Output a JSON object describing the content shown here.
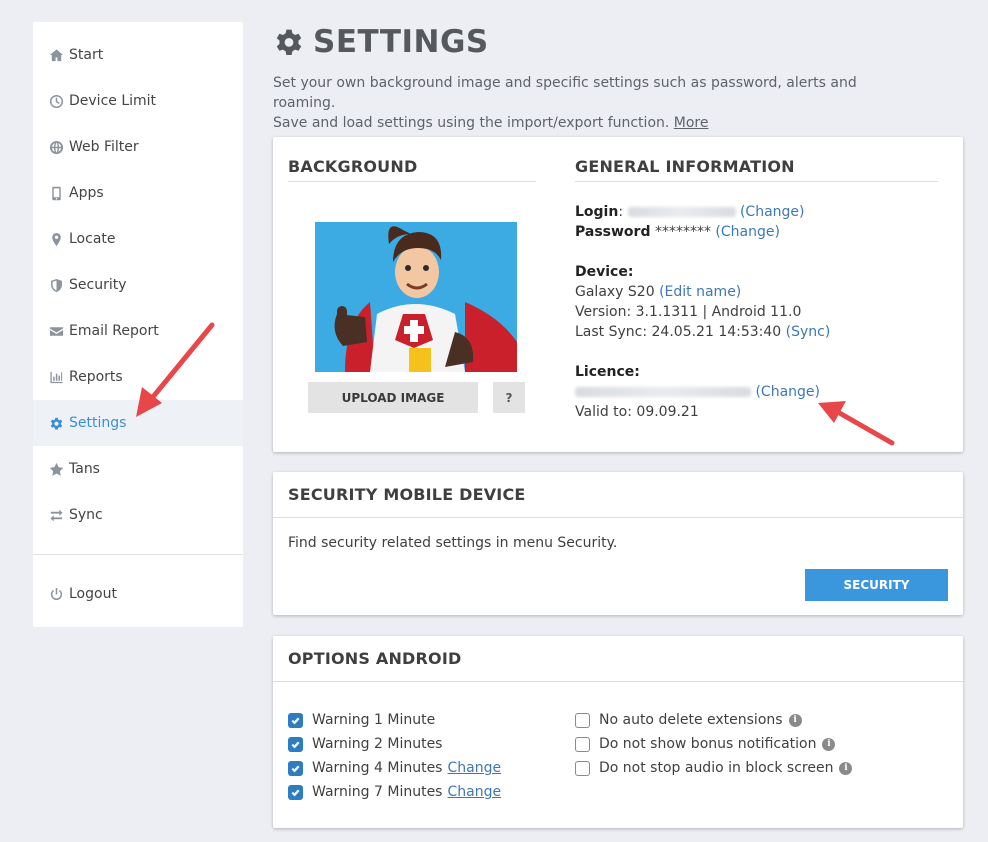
{
  "sidebar": {
    "items": [
      {
        "label": "Start",
        "icon": "home-icon"
      },
      {
        "label": "Device Limit",
        "icon": "clock-icon"
      },
      {
        "label": "Web Filter",
        "icon": "globe-icon"
      },
      {
        "label": "Apps",
        "icon": "phone-icon"
      },
      {
        "label": "Locate",
        "icon": "map-pin-icon"
      },
      {
        "label": "Security",
        "icon": "shield-icon"
      },
      {
        "label": "Email Report",
        "icon": "envelope-icon"
      },
      {
        "label": "Reports",
        "icon": "bar-chart-icon"
      },
      {
        "label": "Settings",
        "icon": "gear-icon"
      },
      {
        "label": "Tans",
        "icon": "star-icon"
      },
      {
        "label": "Sync",
        "icon": "exchange-icon"
      }
    ],
    "logout_label": "Logout",
    "active_item": "Settings",
    "accent_color": "#3c8fd6"
  },
  "header": {
    "title": "SETTINGS",
    "description_line1": "Set your own background image and specific settings such as password, alerts and roaming.",
    "description_line2": "Save and load settings using the import/export function.",
    "more_link": "More"
  },
  "background_card": {
    "title": "BACKGROUND",
    "upload_label": "UPLOAD IMAGE",
    "help_label": "?"
  },
  "general_info": {
    "title": "GENERAL INFORMATION",
    "login_label": "Login",
    "login_change": "(Change)",
    "password_label": "Password",
    "password_value": "********",
    "password_change": "(Change)",
    "device_label": "Device:",
    "device_name": "Galaxy S20",
    "edit_name": "(Edit name)",
    "version_text": "Version: 3.1.1311 | Android 11.0",
    "last_sync_text": "Last Sync: 24.05.21 14:53:40",
    "sync_link": "(Sync)",
    "licence_label": "Licence:",
    "licence_change": "(Change)",
    "valid_to": "Valid to: 09.09.21"
  },
  "security_card": {
    "title": "SECURITY MOBILE DEVICE",
    "text": "Find security related settings in menu Security.",
    "button_label": "SECURITY",
    "button_color": "#3a96dd"
  },
  "options_card": {
    "title": "OPTIONS ANDROID",
    "left_options": [
      {
        "label": "Warning 1 Minute",
        "checked": true,
        "change": ""
      },
      {
        "label": "Warning 2 Minutes",
        "checked": true,
        "change": ""
      },
      {
        "label": "Warning 4 Minutes",
        "checked": true,
        "change": "Change"
      },
      {
        "label": "Warning 7 Minutes",
        "checked": true,
        "change": "Change"
      }
    ],
    "right_options": [
      {
        "label": "No auto delete extensions",
        "checked": false
      },
      {
        "label": "Do not show bonus notification",
        "checked": false
      },
      {
        "label": "Do not stop audio in block screen",
        "checked": false
      }
    ],
    "info_glyph": "i"
  },
  "annotation_color": "#e8474a"
}
